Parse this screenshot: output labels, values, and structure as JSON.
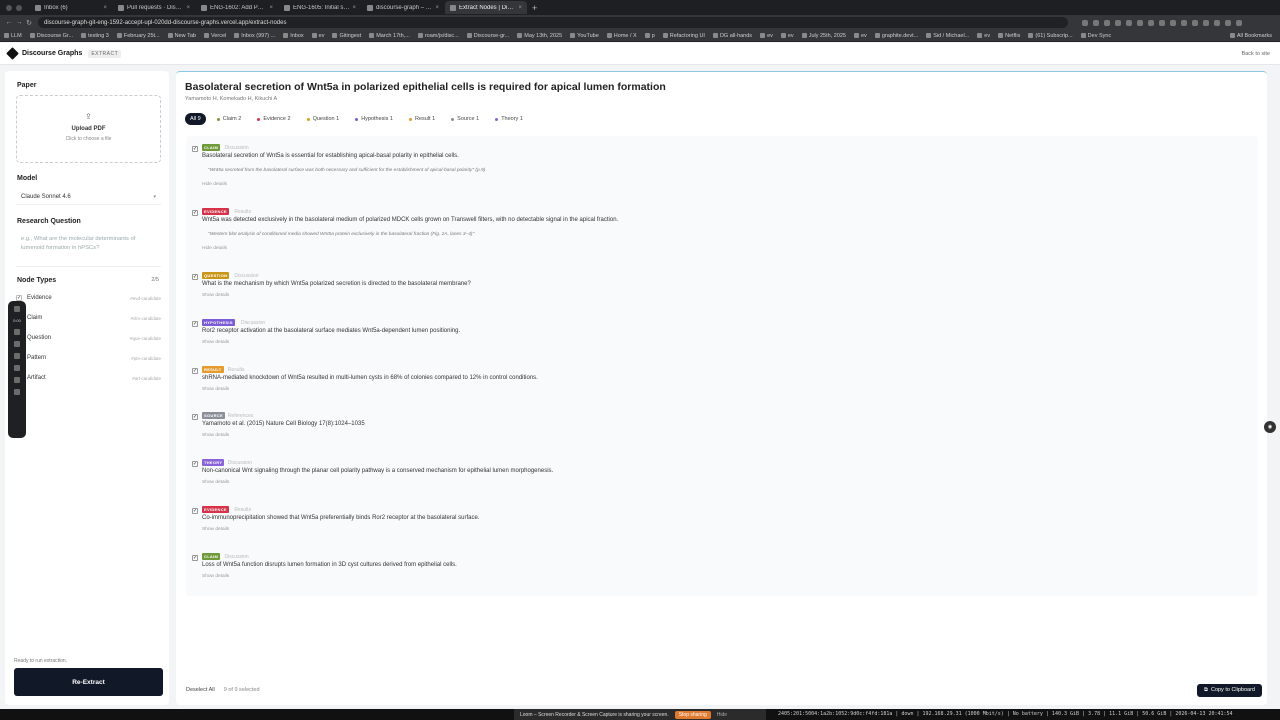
{
  "browser": {
    "tabs": [
      {
        "label": "Inbox (6)",
        "active": false
      },
      {
        "label": "Pull requests · Discou",
        "active": false
      },
      {
        "label": "ENG-1602: Add PDF ex",
        "active": false
      },
      {
        "label": "ENG-1605: Initial skel",
        "active": false
      },
      {
        "label": "discourse-graph – Dep",
        "active": false
      },
      {
        "label": "Extract Nodes | Disco",
        "active": true
      }
    ],
    "url": "discourse-graph-git-eng-1592-accept-upl-020dd-discourse-graphs.vercel.app/extract-nodes",
    "bookmarks": [
      "LLM",
      "Discourse Gr...",
      "testing 3",
      "February 25t...",
      "New Tab",
      "Vercel",
      "Inbox (997) ...",
      "Inbox",
      "ev",
      "Gitingest",
      "March 17th,...",
      "roam/js/disc...",
      "Discourse-gr...",
      "May 13th, 2025",
      "YouTube",
      "Home / X",
      "p",
      "Refactoring UI",
      "DG all-hands",
      "ev",
      "ev",
      "July 25th, 2025",
      "ev",
      "graphite.devt...",
      "Sid / Michael...",
      "ev",
      "Netflix",
      "(61) Subscrip...",
      "Dev Sync"
    ],
    "all_bookmarks": "All Bookmarks"
  },
  "app": {
    "brand": "Discourse Graphs",
    "brand_tag": "EXTRACT",
    "back_link": "Back to site"
  },
  "sidebar": {
    "paper_label": "Paper",
    "upload_title": "Upload PDF",
    "upload_sub": "Click to choose a file",
    "model_label": "Model",
    "model_value": "Claude Sonnet 4.6",
    "rq_label": "Research Question",
    "rq_placeholder": "e.g., What are the molecular determinants of lumenoid formation in hPSCs?",
    "node_types_label": "Node Types",
    "node_types_count": "2/5",
    "node_types": [
      {
        "label": "Evidence",
        "sub": "#evd-candidate",
        "checked": true
      },
      {
        "label": "Claim",
        "sub": "#clm-candidate",
        "checked": true
      },
      {
        "label": "Question",
        "sub": "#que-candidate",
        "checked": false
      },
      {
        "label": "Pattern",
        "sub": "#ptn-candidate",
        "checked": false
      },
      {
        "label": "Artifact",
        "sub": "#art-candidate",
        "checked": false
      }
    ],
    "status": "Ready to run extraction.",
    "reextract": "Re-Extract"
  },
  "recorder": {
    "time": "0:00"
  },
  "main": {
    "title": "Basolateral secretion of Wnt5a in polarized epithelial cells is required for apical lumen formation",
    "authors": "Yamamoto H, Komekado H, Kikuchi A",
    "filters": [
      {
        "label": "All 9",
        "color": "",
        "active": true
      },
      {
        "label": "Claim 2",
        "color": "#7a9a3a",
        "active": false
      },
      {
        "label": "Evidence 2",
        "color": "#d6334a",
        "active": false
      },
      {
        "label": "Question 1",
        "color": "#d9a21b",
        "active": false
      },
      {
        "label": "Hypothesis 1",
        "color": "#7b5bd6",
        "active": false
      },
      {
        "label": "Result 1",
        "color": "#e59a2e",
        "active": false
      },
      {
        "label": "Source 1",
        "color": "#8a8f99",
        "active": false
      },
      {
        "label": "Theory 1",
        "color": "#8b63d9",
        "active": false
      }
    ],
    "nodes": [
      {
        "type": "CLAIM",
        "color": "#6f9a3a",
        "section": "Discussion",
        "text": "Basolateral secretion of Wnt5a is essential for establishing apical-basal polarity in epithelial cells.",
        "quote": "\"Wnt5a secreted from the basolateral surface was both necessary and sufficient for the establishment of apical-basal polarity\" (p.9)",
        "toggle": "Hide details"
      },
      {
        "type": "EVIDENCE",
        "color": "#d6334a",
        "section": "Results",
        "text": "Wnt5a was detected exclusively in the basolateral medium of polarized MDCK cells grown on Transwell filters, with no detectable signal in the apical fraction.",
        "quote": "\"Western blot analysis of conditioned media showed Wnt5a protein exclusively in the basolateral fraction (Fig. 2A, lanes 3–4)\"",
        "toggle": "Hide details"
      },
      {
        "type": "QUESTION",
        "color": "#c9961a",
        "section": "Discussion",
        "text": "What is the mechanism by which Wnt5a polarized secretion is directed to the basolateral membrane?",
        "quote": "",
        "toggle": "Show details"
      },
      {
        "type": "HYPOTHESIS",
        "color": "#7b5bd6",
        "section": "Discussion",
        "text": "Ror2 receptor activation at the basolateral surface mediates Wnt5a-dependent lumen positioning.",
        "quote": "",
        "toggle": "Show details"
      },
      {
        "type": "RESULT",
        "color": "#e59a2e",
        "section": "Results",
        "text": "shRNA-mediated knockdown of Wnt5a resulted in multi-lumen cysts in 68% of colonies compared to 12% in control conditions.",
        "quote": "",
        "toggle": "Show details"
      },
      {
        "type": "SOURCE",
        "color": "#8a8f99",
        "section": "References",
        "text": "Yamamoto et al. (2015) Nature Cell Biology 17(8):1024–1035",
        "quote": "",
        "toggle": "Show details"
      },
      {
        "type": "THEORY",
        "color": "#8b63d9",
        "section": "Discussion",
        "text": "Non-canonical Wnt signaling through the planar cell polarity pathway is a conserved mechanism for epithelial lumen morphogenesis.",
        "quote": "",
        "toggle": "Show details"
      },
      {
        "type": "EVIDENCE",
        "color": "#d6334a",
        "section": "Results",
        "text": "Co-immunoprecipitation showed that Wnt5a preferentially binds Ror2 receptor at the basolateral surface.",
        "quote": "",
        "toggle": "Show details"
      },
      {
        "type": "CLAIM",
        "color": "#6f9a3a",
        "section": "Discussion",
        "text": "Loss of Wnt5a function disrupts lumen formation in 3D cyst cultures derived from epithelial cells.",
        "quote": "",
        "toggle": "Show details"
      }
    ],
    "deselect_all": "Deselect All",
    "selected_count": "9 of 9 selected",
    "copy_button": "Copy to Clipboard"
  },
  "loom": {
    "message": "Loom – Screen Recorder & Screen Capture is sharing your screen.",
    "stop": "Stop sharing",
    "hide": "Hide"
  },
  "statusline": "2405:201:5004:1a2b:1052:9d0c:f4fd:181a | down | 192.168.29.31 (1000 Mbit/s) | No battery | 140.3 GiB | 3.78 | 11.1 GiB | 50.6 GiB | 2026-04-13 20:41:54"
}
